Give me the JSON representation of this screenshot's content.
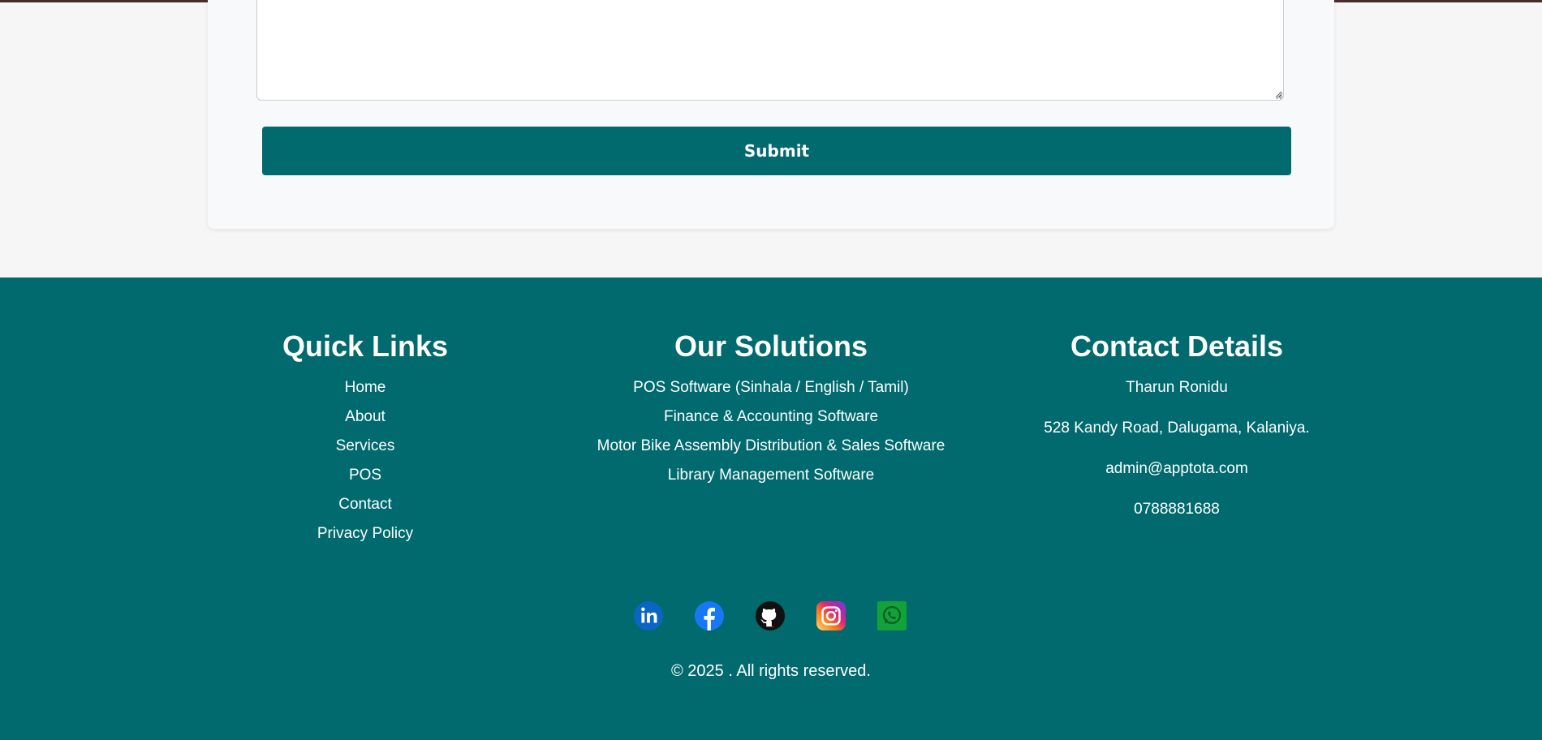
{
  "form": {
    "message_placeholder": "",
    "submit_label": "Submit"
  },
  "footer": {
    "quick_links": {
      "title": "Quick Links",
      "items": [
        "Home",
        "About",
        "Services",
        "POS",
        "Contact",
        "Privacy Policy"
      ]
    },
    "solutions": {
      "title": "Our Solutions",
      "items": [
        "POS Software (Sinhala / English / Tamil)",
        "Finance & Accounting Software",
        "Motor Bike Assembly Distribution & Sales Software",
        "Library Management Software"
      ]
    },
    "contact": {
      "title": "Contact Details",
      "name": "Tharun Ronidu",
      "address": "528 Kandy Road, Dalugama, Kalaniya.",
      "email": "admin@apptota.com",
      "phone": "0788881688"
    },
    "socials": [
      "linkedin-icon",
      "facebook-icon",
      "github-icon",
      "instagram-icon",
      "whatsapp-icon"
    ],
    "copyright": "© 2025 . All rights reserved."
  },
  "colors": {
    "brand_teal": "#006a6e",
    "page_bg": "#f6f6f6",
    "card_bg": "#f8f9fb"
  }
}
